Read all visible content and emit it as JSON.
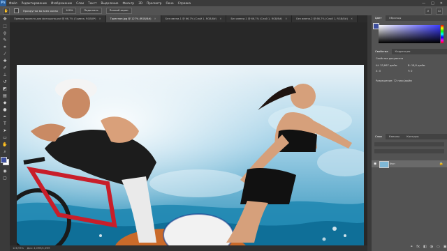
{
  "menubar": {
    "logo": "Ps",
    "items": [
      "Файл",
      "Редактирование",
      "Изображение",
      "Слои",
      "Текст",
      "Выделение",
      "Фильтр",
      "3D",
      "Просмотр",
      "Окно",
      "Справка"
    ],
    "controls": [
      "—",
      "□",
      "✕"
    ]
  },
  "options": {
    "tool_icon": "hand-icon",
    "checkbox_label": "Прокрутка во всех окнах",
    "zoom_btn": "100%",
    "fit_btn": "Подогнать",
    "fill_btn": "Полный экран"
  },
  "tabs": [
    {
      "label": "Превью проекта для фотошопа.psd @ 66,7% (Гривна, RGB/8*)",
      "active": false
    },
    {
      "label": "Триатлон.jpg @ 127% (RGB/8#)",
      "active": true
    },
    {
      "label": "Без имени-1 @ 66,7% (Слой 1, RGB/8#)",
      "active": false
    },
    {
      "label": "Без имени-1 @ 66,7% (Слой 1, RGB/8#)",
      "active": false
    },
    {
      "label": "Без имени-2 @ 66,7% (Слой 1, RGB/8#)",
      "active": false
    }
  ],
  "status": {
    "zoom": "126,93%",
    "doc": "Док: 4,09M/4,09M"
  },
  "panels": {
    "color_tabs": [
      "Цвет",
      "Образцы"
    ],
    "props_tabs": [
      "Свойства",
      "Коррекция"
    ],
    "props_title": "Свойства документа",
    "props_w": "Ш: 33,867 дюйм",
    "props_h": "В: 18,8 дюйм",
    "props_x": "X: 0",
    "props_y": "Y: 0",
    "props_res": "Разрешение: 72 пикс/дюйм",
    "layers_tabs": [
      "Слои",
      "Каналы",
      "Контуры"
    ],
    "layer_name": "Фон"
  },
  "colors": {
    "foreground": "#3d4f9e",
    "background": "#ffffff",
    "accent": "#2b5f9c"
  }
}
